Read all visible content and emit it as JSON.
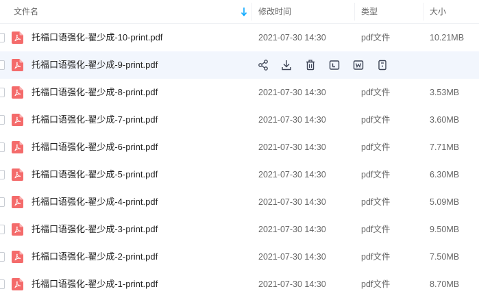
{
  "header": {
    "name": "文件名",
    "modified": "修改时间",
    "type": "类型",
    "size": "大小"
  },
  "files": [
    {
      "name": "托福口语强化-翟少成-10-print.pdf",
      "modified": "2021-07-30 14:30",
      "type": "pdf文件",
      "size": "10.21MB"
    },
    {
      "name": "托福口语强化-翟少成-9-print.pdf",
      "modified": "",
      "type": "",
      "size": "",
      "hover": true
    },
    {
      "name": "托福口语强化-翟少成-8-print.pdf",
      "modified": "2021-07-30 14:30",
      "type": "pdf文件",
      "size": "3.53MB"
    },
    {
      "name": "托福口语强化-翟少成-7-print.pdf",
      "modified": "2021-07-30 14:30",
      "type": "pdf文件",
      "size": "3.60MB"
    },
    {
      "name": "托福口语强化-翟少成-6-print.pdf",
      "modified": "2021-07-30 14:30",
      "type": "pdf文件",
      "size": "7.71MB"
    },
    {
      "name": "托福口语强化-翟少成-5-print.pdf",
      "modified": "2021-07-30 14:30",
      "type": "pdf文件",
      "size": "6.30MB"
    },
    {
      "name": "托福口语强化-翟少成-4-print.pdf",
      "modified": "2021-07-30 14:30",
      "type": "pdf文件",
      "size": "5.09MB"
    },
    {
      "name": "托福口语强化-翟少成-3-print.pdf",
      "modified": "2021-07-30 14:30",
      "type": "pdf文件",
      "size": "9.50MB"
    },
    {
      "name": "托福口语强化-翟少成-2-print.pdf",
      "modified": "2021-07-30 14:30",
      "type": "pdf文件",
      "size": "7.50MB"
    },
    {
      "name": "托福口语强化-翟少成-1-print.pdf",
      "modified": "2021-07-30 14:30",
      "type": "pdf文件",
      "size": "8.70MB"
    }
  ],
  "hover_actions": [
    "share-icon",
    "download-icon",
    "delete-icon",
    "rename-icon",
    "open-word-icon",
    "more-icon"
  ],
  "colors": {
    "pdf_icon": "#f46b6b",
    "accent": "#06a7ff",
    "action_icon": "#3b4254"
  }
}
